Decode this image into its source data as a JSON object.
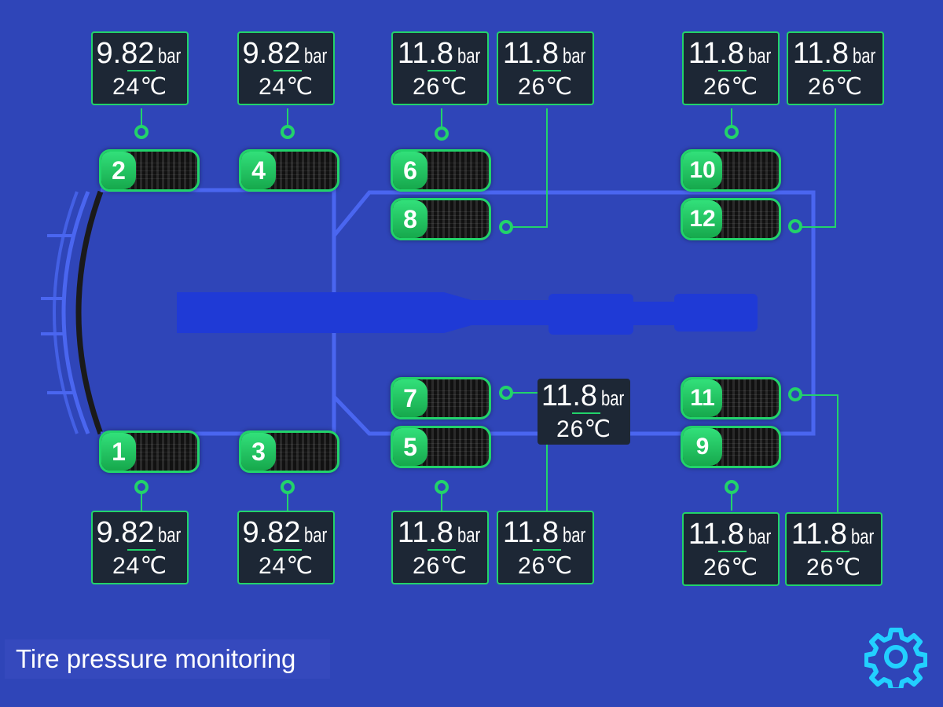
{
  "title": "Tire pressure monitoring",
  "colors": {
    "background": "#2f45b8",
    "accent": "#22d36a",
    "frame": "#4a66f0",
    "panel": "#1d2735",
    "gear": "#22d0ff"
  },
  "icons": {
    "settings": "gear-icon"
  },
  "tires": [
    {
      "id": "1",
      "label": "1",
      "pressure": "9.82",
      "unit": "bar",
      "temp": "24℃"
    },
    {
      "id": "2",
      "label": "2",
      "pressure": "9.82",
      "unit": "bar",
      "temp": "24℃"
    },
    {
      "id": "3",
      "label": "3",
      "pressure": "9.82",
      "unit": "bar",
      "temp": "24℃"
    },
    {
      "id": "4",
      "label": "4",
      "pressure": "9.82",
      "unit": "bar",
      "temp": "24℃"
    },
    {
      "id": "5",
      "label": "5",
      "pressure": "11.8",
      "unit": "bar",
      "temp": "26℃"
    },
    {
      "id": "6",
      "label": "6",
      "pressure": "11.8",
      "unit": "bar",
      "temp": "26℃"
    },
    {
      "id": "7",
      "label": "7",
      "pressure": "11.8",
      "unit": "bar",
      "temp": "26℃"
    },
    {
      "id": "8",
      "label": "8",
      "pressure": "11.8",
      "unit": "bar",
      "temp": "26℃"
    },
    {
      "id": "9",
      "label": "9",
      "pressure": "11.8",
      "unit": "bar",
      "temp": "26℃"
    },
    {
      "id": "10",
      "label": "10",
      "pressure": "11.8",
      "unit": "bar",
      "temp": "26℃"
    },
    {
      "id": "11",
      "label": "11",
      "pressure": "11.8",
      "unit": "bar",
      "temp": "26℃"
    },
    {
      "id": "12",
      "label": "12",
      "pressure": "11.8",
      "unit": "bar",
      "temp": "26℃"
    }
  ]
}
